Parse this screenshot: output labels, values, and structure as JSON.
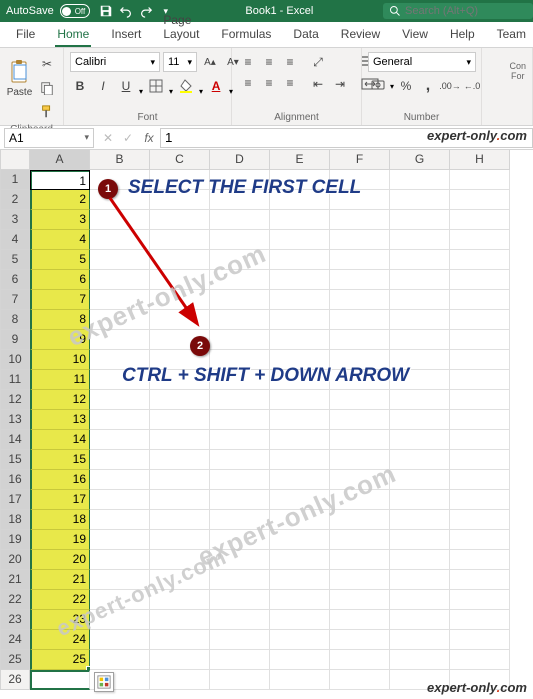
{
  "titlebar": {
    "autosave_label": "AutoSave",
    "autosave_state": "Off",
    "title": "Book1 - Excel",
    "search_placeholder": "Search (Alt+Q)"
  },
  "tabs": {
    "file": "File",
    "home": "Home",
    "insert": "Insert",
    "page_layout": "Page Layout",
    "formulas": "Formulas",
    "data": "Data",
    "review": "Review",
    "view": "View",
    "help": "Help",
    "team": "Team"
  },
  "ribbon": {
    "clipboard": {
      "label": "Clipboard",
      "paste": "Paste"
    },
    "font": {
      "label": "Font",
      "name": "Calibri",
      "size": "11"
    },
    "alignment": {
      "label": "Alignment"
    },
    "number": {
      "label": "Number",
      "format": "General"
    },
    "comments_hint": "Con Fon"
  },
  "fnbar": {
    "namebox": "A1",
    "fx": "fx",
    "formula": "1"
  },
  "columns": [
    "A",
    "B",
    "C",
    "D",
    "E",
    "F",
    "G",
    "H"
  ],
  "rows_total": 26,
  "colA_values": [
    "1",
    "2",
    "3",
    "4",
    "5",
    "6",
    "7",
    "8",
    "9",
    "10",
    "11",
    "12",
    "13",
    "14",
    "15",
    "16",
    "17",
    "18",
    "19",
    "20",
    "21",
    "22",
    "23",
    "24",
    "25"
  ],
  "callouts": {
    "badge1": "1",
    "badge2": "2",
    "text1": "SELECT THE FIRST CELL",
    "text2": "CTRL + SHIFT + DOWN ARROW"
  },
  "watermark_text": "expert-only.com",
  "brand": {
    "text_a": "expert-only",
    "dot": ".",
    "text_b": "com"
  }
}
